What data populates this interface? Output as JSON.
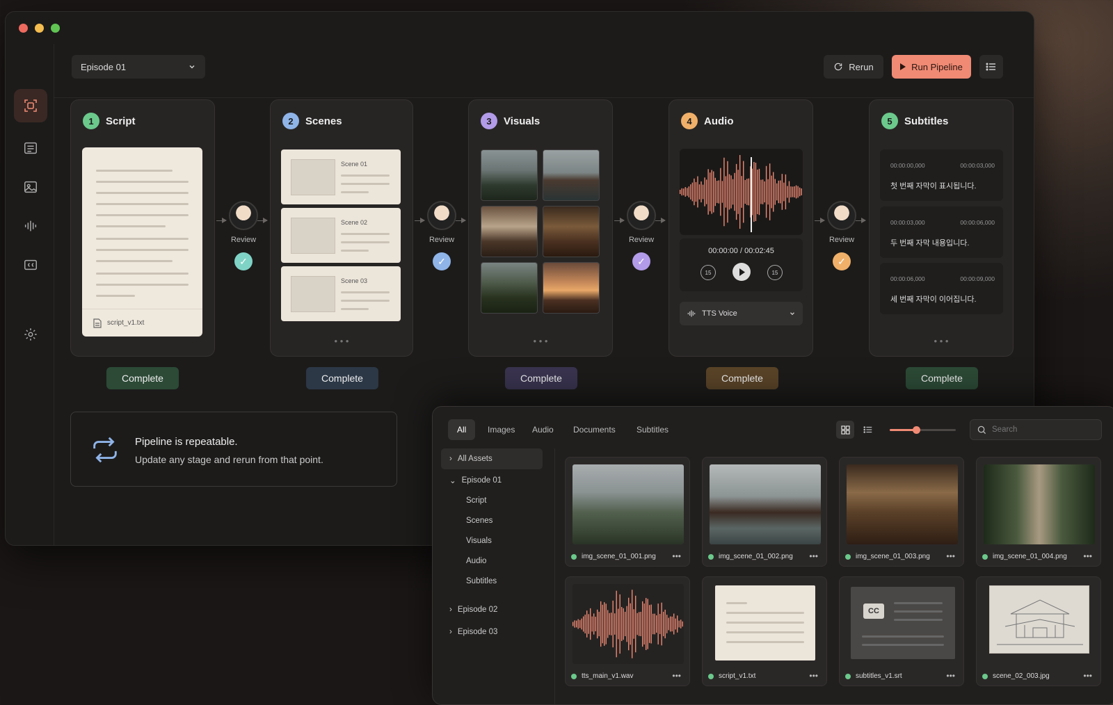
{
  "window": {
    "controls": [
      "close",
      "minimize",
      "maximize"
    ]
  },
  "toolbar": {
    "episode": "Episode 01",
    "rerun_label": "Rerun",
    "run_label": "Run Pipeline"
  },
  "colors": {
    "accent": "#f08a74",
    "green": "#6bc98c",
    "blue": "#8fb4e8",
    "purple": "#b29be8",
    "orange": "#f0b06a",
    "teal": "#7fd3c6"
  },
  "sidebar": {
    "items": [
      "pipeline-icon",
      "list-icon",
      "image-icon",
      "audio-icon",
      "cc-icon",
      "gear-icon"
    ]
  },
  "stages": [
    {
      "num": "1",
      "title": "Script",
      "status": "Complete"
    },
    {
      "num": "2",
      "title": "Scenes",
      "status": "Complete"
    },
    {
      "num": "3",
      "title": "Visuals",
      "status": "Complete"
    },
    {
      "num": "4",
      "title": "Audio",
      "status": "Complete"
    },
    {
      "num": "5",
      "title": "Subtitles",
      "status": "Complete"
    }
  ],
  "review_label": "Review",
  "script": {
    "file": "script_v1.txt"
  },
  "scenes": [
    "Scene 01",
    "Scene 02",
    "Scene 03"
  ],
  "audio": {
    "time": "00:00:00 / 00:02:45",
    "voice": "TTS Voice",
    "skip": "15"
  },
  "subtitles": [
    {
      "start": "00:00:00,000",
      "end": "00:00:03,000",
      "text": "첫 번째 자막이 표시됩니다."
    },
    {
      "start": "00:00:03,000",
      "end": "00:00:06,000",
      "text": "두 번째 자막 내용입니다."
    },
    {
      "start": "00:00:06,000",
      "end": "00:00:09,000",
      "text": "세 번째 자막이 이어집니다."
    }
  ],
  "info": {
    "title": "Pipeline is repeatable.",
    "body": "Update any stage and rerun from that point."
  },
  "assets_panel": {
    "tabs": [
      "All",
      "Images",
      "Audio",
      "Documents",
      "Subtitles"
    ],
    "search_placeholder": "Search",
    "zoom": 0.4,
    "tree": {
      "all": "All Assets",
      "episode1": "Episode 01",
      "children": [
        "Script",
        "Scenes",
        "Visuals",
        "Audio",
        "Subtitles"
      ],
      "episode2": "Episode 02",
      "episode3": "Episode 03"
    },
    "files": [
      "img_scene_01_001.png",
      "img_scene_01_002.png",
      "img_scene_01_003.png",
      "img_scene_01_004.png",
      "tts_main_v1.wav",
      "script_v1.txt",
      "subtitles_v1.srt",
      "scene_02_003.jpg"
    ],
    "cc_badge": "CC"
  }
}
